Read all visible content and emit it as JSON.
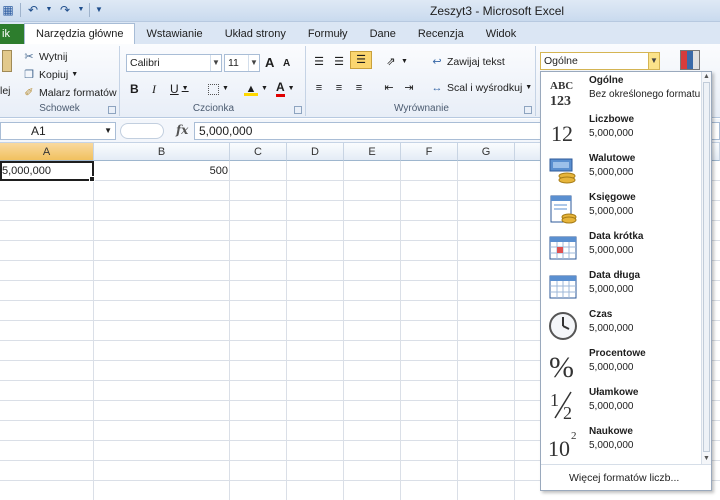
{
  "window": {
    "title": "Zeszyt3 - Microsoft Excel"
  },
  "tabs": [
    {
      "label": "ik"
    },
    {
      "label": "Narzędzia główne"
    },
    {
      "label": "Wstawianie"
    },
    {
      "label": "Układ strony"
    },
    {
      "label": "Formuły"
    },
    {
      "label": "Dane"
    },
    {
      "label": "Recenzja"
    },
    {
      "label": "Widok"
    }
  ],
  "ribbon": {
    "clipboard": {
      "label": "Schowek",
      "cut": "Wytnij",
      "copy": "Kopiuj",
      "painter": "Malarz formatów",
      "paste_fragment": "lej"
    },
    "font": {
      "label": "Czcionka",
      "font_name": "Calibri",
      "font_size": "11",
      "bold": "B",
      "italic": "I",
      "underline": "U",
      "grow": "A",
      "shrink": "A",
      "font_color": "A"
    },
    "alignment": {
      "label": "Wyrównanie",
      "wrap": "Zawijaj tekst",
      "merge": "Scal i wyśrodkuj"
    },
    "number": {
      "format_value": "Ogólne"
    }
  },
  "formula_bar": {
    "name_box": "A1",
    "fx": "fx",
    "content": "5,000,000"
  },
  "grid": {
    "columns": [
      "A",
      "B",
      "C",
      "D",
      "E",
      "F",
      "G"
    ],
    "cells": {
      "A1": "5,000,000",
      "B1": "500"
    }
  },
  "number_format_menu": {
    "items": [
      {
        "name": "Ogólne",
        "value": "Bez określonego formatu",
        "icon": "general-format-icon"
      },
      {
        "name": "Liczbowe",
        "value": "5,000,000",
        "icon": "number-format-icon"
      },
      {
        "name": "Walutowe",
        "value": "5,000,000",
        "icon": "currency-format-icon"
      },
      {
        "name": "Księgowe",
        "value": " 5,000,000",
        "icon": "accounting-format-icon"
      },
      {
        "name": "Data krótka",
        "value": "5,000,000",
        "icon": "short-date-format-icon"
      },
      {
        "name": "Data długa",
        "value": "5,000,000",
        "icon": "long-date-format-icon"
      },
      {
        "name": "Czas",
        "value": "5,000,000",
        "icon": "time-format-icon"
      },
      {
        "name": "Procentowe",
        "value": "5,000,000",
        "icon": "percentage-format-icon"
      },
      {
        "name": "Ułamkowe",
        "value": "5,000,000",
        "icon": "fraction-format-icon"
      },
      {
        "name": "Naukowe",
        "value": "5,000,000",
        "icon": "scientific-format-icon"
      }
    ],
    "more": "Więcej formatów liczb..."
  },
  "colors": {
    "file_tab": "#2d7d2d",
    "selected_header": "#f1c15f",
    "ribbon_bg": "#e8eef7"
  }
}
